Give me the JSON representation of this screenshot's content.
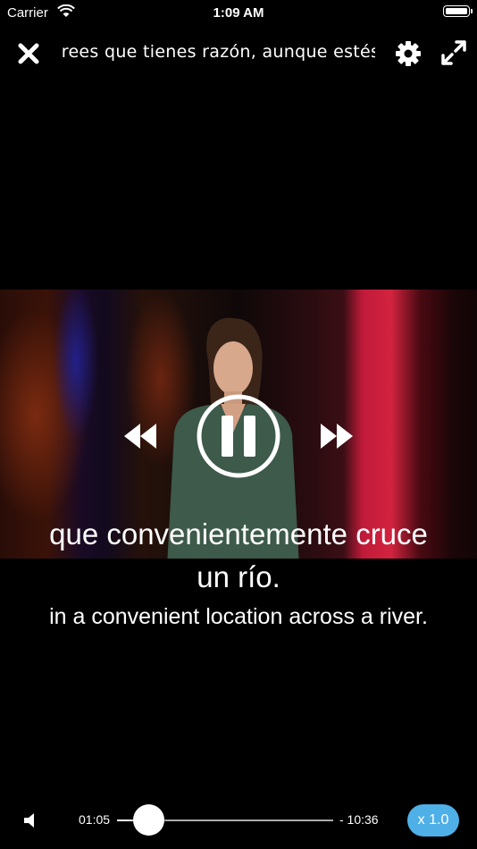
{
  "status_bar": {
    "carrier": "Carrier",
    "time": "1:09 AM"
  },
  "top_bar": {
    "marquee_text": "crees que tienes razón, aunque estés eq"
  },
  "controls": {
    "rewind_icon": "rewind-icon",
    "play_pause_icon": "pause-icon",
    "forward_icon": "fast-forward-icon"
  },
  "subtitles": {
    "spanish_line1": "que convenientemente cruce",
    "spanish_line2": "un río.",
    "english": "in a convenient location across a river."
  },
  "player": {
    "elapsed": "01:05",
    "remaining": "- 10:36",
    "progress": 0.093,
    "speed": "x 1.0"
  },
  "colors": {
    "background": "#000000",
    "accent": "#4fb0e8"
  }
}
